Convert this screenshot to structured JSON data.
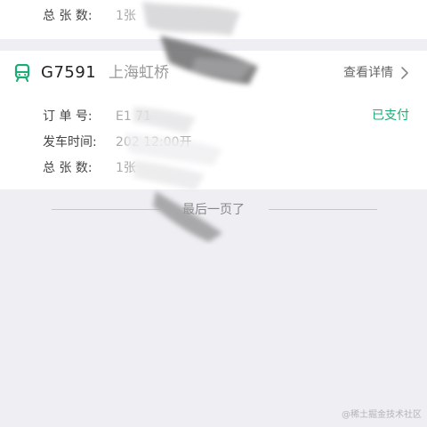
{
  "top_card": {
    "total_label": "总 张 数:",
    "total_value": "1张"
  },
  "order_card": {
    "train_icon": "train-icon",
    "train_no": "G7591",
    "station": "上海虹桥",
    "detail_label": "查看详情",
    "chevron_icon": "chevron-right-icon",
    "status": "已支付",
    "order_label": "订 单 号:",
    "order_value": "E1 71",
    "depart_label": "发车时间:",
    "depart_value": "202 12:00开",
    "total_label": "总 张 数:",
    "total_value": "1张"
  },
  "end_text": "最后一页了",
  "watermark": "@稀土掘金技术社区",
  "colors": {
    "background": "#efeef3",
    "card": "#ffffff",
    "accent_green": "#1aad73"
  }
}
